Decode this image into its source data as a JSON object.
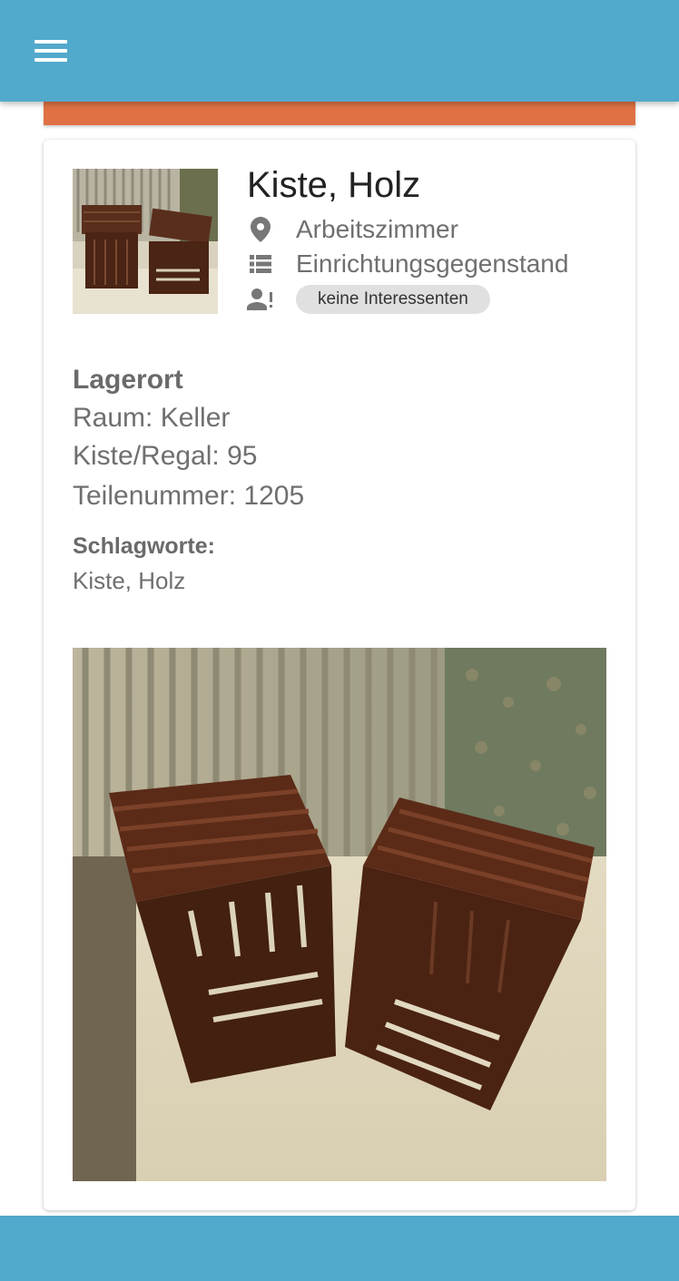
{
  "colors": {
    "appbar": "#51a9cc",
    "accent_strip": "#e07145",
    "bottombar": "#51a9cc",
    "icon": "#777777"
  },
  "appbar": {
    "menu_icon": "hamburger-menu-icon"
  },
  "item": {
    "title": "Kiste, Holz",
    "room": "Arbeitszimmer",
    "category": "Einrichtungsgegenstand",
    "interest_chip": "keine Interessenten",
    "icons": {
      "room": "location-pin-icon",
      "category": "list-icon",
      "interest": "person-alert-icon"
    }
  },
  "storage": {
    "heading": "Lagerort",
    "raum": "Raum: Keller",
    "kiste_regal": "Kiste/Regal: 95",
    "teilenummer": "Teilenummer: 1205"
  },
  "tags": {
    "heading": "Schlagworte:",
    "value": "Kiste, Holz"
  }
}
